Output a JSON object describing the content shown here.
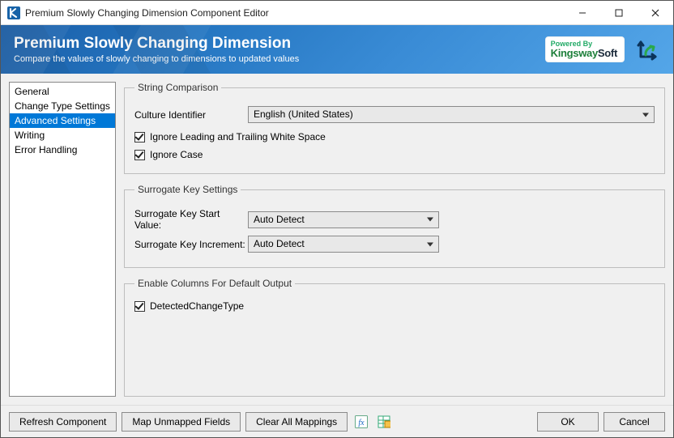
{
  "window": {
    "title": "Premium Slowly Changing Dimension Component Editor"
  },
  "banner": {
    "heading": "Premium Slowly Changing Dimension",
    "subheading": "Compare the values of slowly changing to dimensions to updated values",
    "powered_prefix": "Powered By",
    "brand_part1": "Kingsway",
    "brand_part2": "Soft"
  },
  "sidebar": {
    "items": [
      {
        "label": "General",
        "selected": false
      },
      {
        "label": "Change Type Settings",
        "selected": false
      },
      {
        "label": "Advanced Settings",
        "selected": true
      },
      {
        "label": "Writing",
        "selected": false
      },
      {
        "label": "Error Handling",
        "selected": false
      }
    ]
  },
  "groups": {
    "string_comparison": {
      "legend": "String Comparison",
      "culture_label": "Culture Identifier",
      "culture_value": "English (United States)",
      "ignore_ws_label": "Ignore Leading and Trailing White Space",
      "ignore_ws_checked": true,
      "ignore_case_label": "Ignore Case",
      "ignore_case_checked": true
    },
    "surrogate": {
      "legend": "Surrogate Key Settings",
      "start_label": "Surrogate Key Start Value:",
      "start_value": "Auto Detect",
      "incr_label": "Surrogate Key Increment:",
      "incr_value": "Auto Detect"
    },
    "enable_columns": {
      "legend": "Enable Columns For Default Output",
      "detected_label": "DetectedChangeType",
      "detected_checked": true
    }
  },
  "footer": {
    "refresh": "Refresh Component",
    "map_unmapped": "Map Unmapped Fields",
    "clear_all": "Clear All Mappings",
    "ok": "OK",
    "cancel": "Cancel"
  }
}
